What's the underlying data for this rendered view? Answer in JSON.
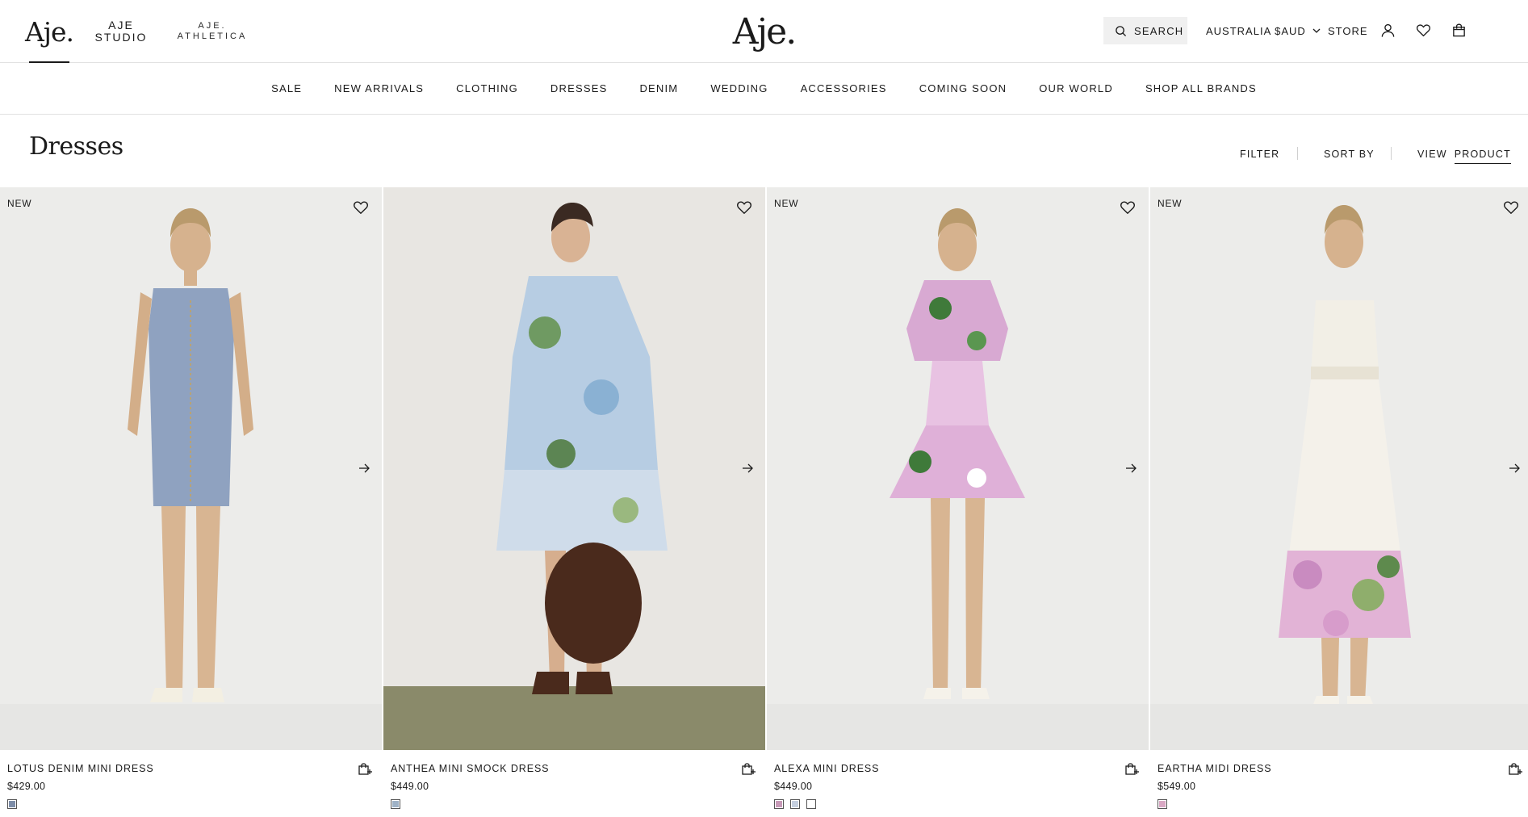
{
  "header": {
    "brands": [
      "Aje.",
      "AJE\nSTUDIO",
      "AJE.\nATHLETICA"
    ],
    "logo": "Aje.",
    "search_label": "SEARCH",
    "currency": "AUSTRALIA $AUD",
    "store_label": "STORE",
    "icons": [
      "account-icon",
      "wishlist-icon",
      "bag-icon"
    ]
  },
  "nav": [
    "SALE",
    "NEW ARRIVALS",
    "CLOTHING",
    "DRESSES",
    "DENIM",
    "WEDDING",
    "ACCESSORIES",
    "COMING SOON",
    "OUR WORLD",
    "SHOP ALL BRANDS"
  ],
  "page": {
    "title": "Dresses",
    "filter_label": "FILTER",
    "sort_label": "SORT BY",
    "view_label": "VIEW",
    "view_value": "PRODUCT"
  },
  "products": [
    {
      "badge": "NEW",
      "name": "LOTUS DENIM MINI DRESS",
      "price": "$429.00",
      "swatches": [
        "#7d8da8"
      ]
    },
    {
      "badge": "",
      "name": "ANTHEA MINI SMOCK DRESS",
      "price": "$449.00",
      "swatches": [
        "#9fb2c6"
      ]
    },
    {
      "badge": "NEW",
      "name": "ALEXA MINI DRESS",
      "price": "$449.00",
      "swatches": [
        "#c79ab8",
        "#c5cfdf",
        "#ffffff"
      ]
    },
    {
      "badge": "NEW",
      "name": "EARTHA MIDI DRESS",
      "price": "$549.00",
      "swatches": [
        "#d9a8c4"
      ]
    }
  ],
  "colors": {
    "text": "#1a1a1a",
    "border": "#e2e2e2",
    "search_bg": "#f0f0f0",
    "photo_bg": "#ececea"
  }
}
